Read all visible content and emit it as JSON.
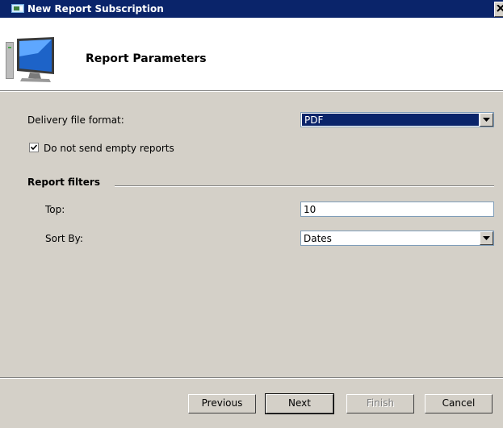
{
  "window": {
    "title": "New Report Subscription"
  },
  "header": {
    "title": "Report Parameters",
    "icon": "monitor-icon"
  },
  "form": {
    "delivery_format_label": "Delivery file format:",
    "delivery_format_value": "PDF",
    "empty_reports_label": "Do not send empty reports",
    "empty_reports_checked": true,
    "filters_group_label": "Report filters",
    "top_label": "Top:",
    "top_value": "10",
    "sort_by_label": "Sort By:",
    "sort_by_value": "Dates"
  },
  "buttons": {
    "previous": "Previous",
    "next": "Next",
    "finish": "Finish",
    "cancel": "Cancel"
  },
  "colors": {
    "titlebar": "#0a246a",
    "dialog_face": "#d4d0c8",
    "selection": "#0a246a"
  }
}
